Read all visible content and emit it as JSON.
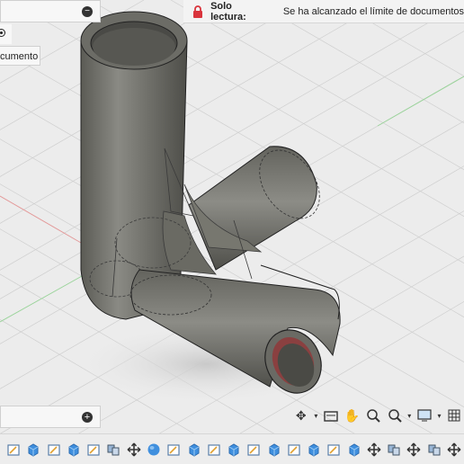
{
  "banner": {
    "title": "Solo lectura:",
    "message": "Se ha alcanzado el límite de documentos"
  },
  "left_panel": {
    "partial_label": "cumento"
  },
  "colors": {
    "lock": "#d9343c",
    "part_fill": "#6e6e68",
    "grid": "#c9c9c9",
    "accent_blue": "#3f8fde"
  },
  "nav_icons": [
    "orbit-icon",
    "look-at-icon",
    "pan-icon",
    "zoom-icon",
    "fit-icon",
    "display-settings-icon",
    "grid-settings-icon"
  ],
  "timeline_icons": [
    "sketch",
    "box",
    "sketch",
    "box",
    "sketch",
    "joint",
    "move",
    "sphere",
    "sketch",
    "box",
    "sketch",
    "box",
    "sketch",
    "box",
    "sketch",
    "box",
    "sketch",
    "box",
    "move",
    "joint",
    "move",
    "joint",
    "move"
  ]
}
